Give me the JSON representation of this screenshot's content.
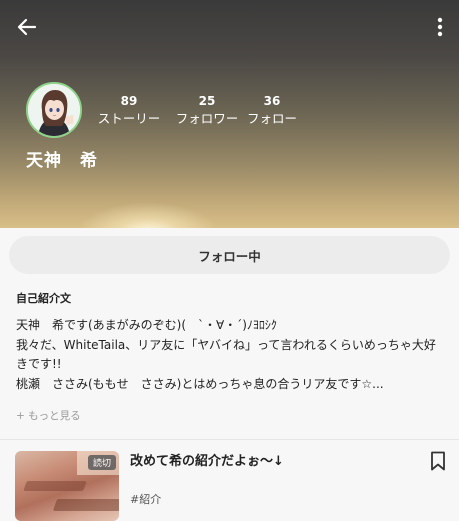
{
  "header": {
    "back_icon": "arrow-left-icon",
    "menu_icon": "more-vertical-icon"
  },
  "profile": {
    "name": "天神　希",
    "stats": {
      "stories": {
        "count": "89",
        "label": "ストーリー"
      },
      "followers": {
        "count": "25",
        "label": "フォロワー"
      },
      "following": {
        "count": "36",
        "label": "フォロー"
      }
    },
    "follow_button_label": "フォロー中"
  },
  "bio": {
    "heading": "自己紹介文",
    "lines": [
      "天神　希です(あまがみのぞむ)(　`・∀・´)ﾉﾖﾛｼｸ",
      "我々だ、WhiteTaila、リア友に「ヤバイね」って言われるくらいめっちゃ大好",
      "きです!!",
      "桃瀬　ささみ(ももせ　ささみ)とはめっちゃ息の合うリア友です☆..."
    ],
    "show_more": "+ もっと見る"
  },
  "story": {
    "badge": "読切",
    "title": "改めて希の紹介だよぉ〜↓",
    "tag": "#紹介",
    "bookmark_icon": "bookmark-icon"
  },
  "colors": {
    "avatar_ring": "#8fd38a",
    "follow_button_bg": "#ececec"
  }
}
